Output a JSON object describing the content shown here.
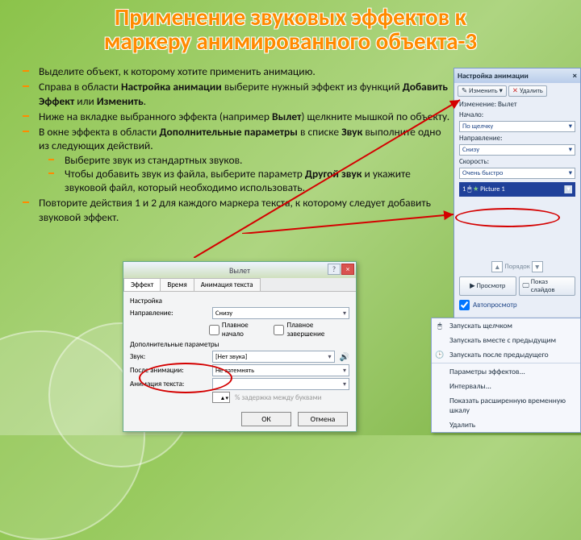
{
  "title_line1": "Применение звуковых эффектов к",
  "title_line2": "маркеру анимированного объекта-3",
  "bullets": {
    "b1": "Выделите объект, к которому хотите применить анимацию.",
    "b2a": "Справа в области ",
    "b2b": "Настройка анимации",
    "b2c": " выберите нужный эффект  из  функций ",
    "b2d": "Добавить Эффект",
    "b2e": " или ",
    "b2f": "Изменить",
    "b2g": ".",
    "b3a": "Ниже  на вкладке выбранного эффекта (например ",
    "b3b": "Вылет",
    "b3c": ") щелкните мышкой по объекту.",
    "b4a": "В окне эффекта в области ",
    "b4b": "Дополнительные параметры",
    "b4c": " в списке ",
    "b4d": "Звук",
    "b4e": " выполните одно из следующих действий.",
    "b4s1": "Выберите звук из стандартных звуков.",
    "b4s2a": "Чтобы добавить звук из файла, выберите параметр ",
    "b4s2b": "Другой звук",
    "b4s2c": " и укажите звуковой файл, который необходимо использовать.",
    "b5": "Повторите действия 1 и 2 для каждого маркера текста, к которому следует добавить звуковой эффект."
  },
  "anim_pane": {
    "header": "Настройка анимации",
    "change": "Изменить",
    "remove": "Удалить",
    "change_label": "Изменение: Вылет",
    "start_label": "Начало:",
    "start_value": "По щелчку",
    "dir_label": "Направление:",
    "dir_value": "Снизу",
    "speed_label": "Скорость:",
    "speed_value": "Очень быстро",
    "list_no": "1",
    "list_item": "Picture 1",
    "reorder": "Порядок",
    "play": "Просмотр",
    "slideshow": "Показ слайдов",
    "autopreview": "Автопросмотр"
  },
  "ctx": {
    "m1": "Запускать щелчком",
    "m2": "Запускать вместе с предыдущим",
    "m3": "Запускать после предыдущего",
    "m4": "Параметры эффектов...",
    "m5": "Интервалы...",
    "m6": "Показать расширенную временную шкалу",
    "m7": "Удалить"
  },
  "dialog": {
    "title": "Вылет",
    "tab1": "Эффект",
    "tab2": "Время",
    "tab3": "Анимация текста",
    "group1": "Настройка",
    "dir_label": "Направление:",
    "dir_value": "Снизу",
    "smooth_start": "Плавное начало",
    "smooth_end": "Плавное завершение",
    "group2": "Дополнительные параметры",
    "sound_label": "Звук:",
    "sound_value": "[Нет звука]",
    "after_label": "После анимации:",
    "after_value": "Не затемнять",
    "text_anim_label": "Анимация текста:",
    "letter_delay": "% задержка между буквами",
    "ok": "ОК",
    "cancel": "Отмена"
  }
}
